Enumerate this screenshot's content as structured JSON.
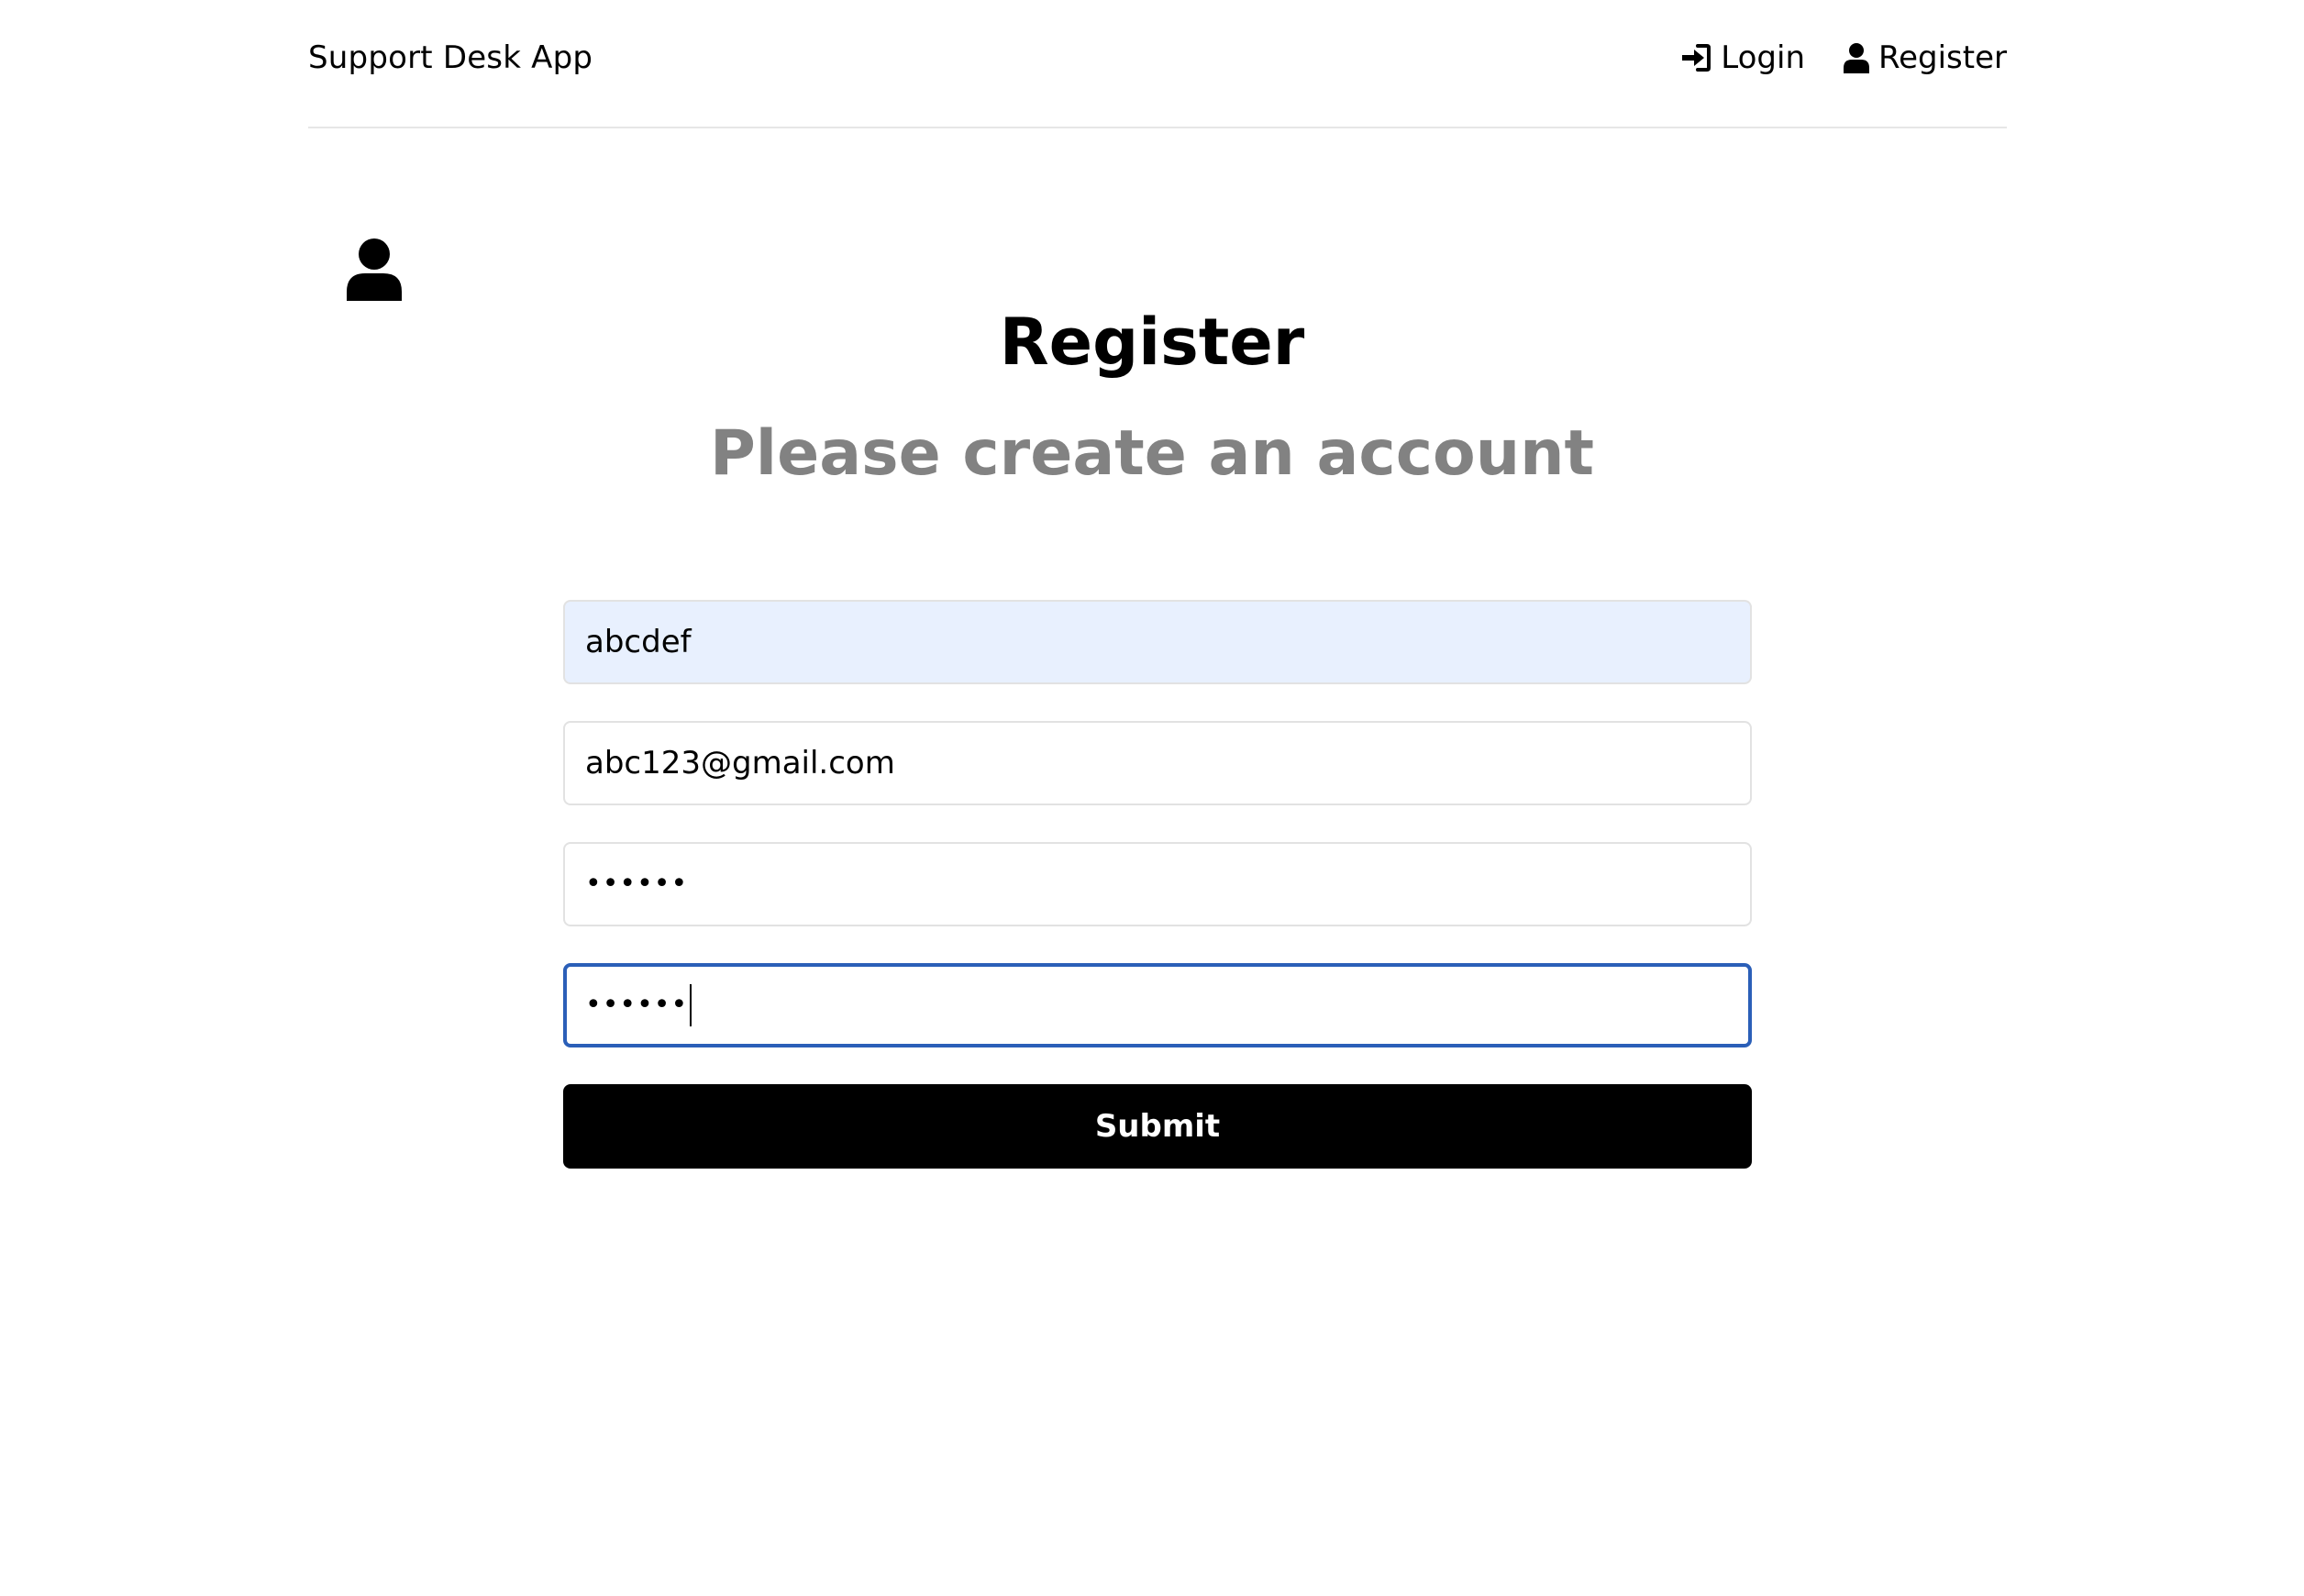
{
  "header": {
    "brand": "Support Desk App",
    "nav": [
      {
        "label": "Login",
        "icon": "sign-in-icon"
      },
      {
        "label": "Register",
        "icon": "user-icon"
      }
    ]
  },
  "hero": {
    "icon": "user-icon",
    "title": "Register",
    "subtitle": "Please create an account"
  },
  "form": {
    "name_value": "abcdef",
    "email_value": "abc123@gmail.com",
    "password_value": "••••••",
    "password_confirm_value": "••••••",
    "submit_label": "Submit"
  },
  "colors": {
    "subtitle": "#828282",
    "autofill_bg": "#e8f0fe",
    "focus_border": "#2b5fb8",
    "button_bg": "#000000"
  }
}
